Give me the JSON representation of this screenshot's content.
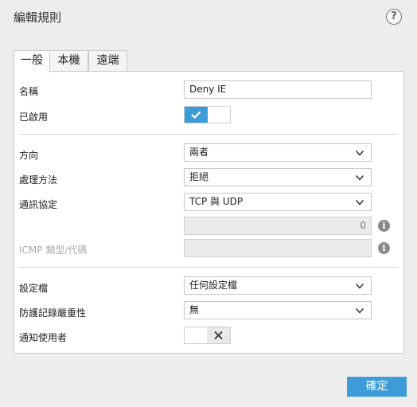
{
  "dialog": {
    "title": "編輯規則",
    "help_label": "?"
  },
  "tabs": [
    {
      "label": "一般"
    },
    {
      "label": "本機"
    },
    {
      "label": "遠端"
    }
  ],
  "fields": {
    "name": {
      "label": "名稱",
      "value": "Deny IE"
    },
    "enabled": {
      "label": "已啟用",
      "state": true
    },
    "direction": {
      "label": "方向",
      "value": "兩者"
    },
    "action": {
      "label": "處理方法",
      "value": "拒絕"
    },
    "protocol": {
      "label": "通訊協定",
      "value": "TCP 與 UDP"
    },
    "protocol_number": {
      "value": "0"
    },
    "icmp": {
      "label": "ICMP 類型/代碼",
      "value": ""
    },
    "profile": {
      "label": "設定檔",
      "value": "任何設定檔"
    },
    "log_severity": {
      "label": "防護記錄嚴重性",
      "value": "無"
    },
    "notify_user": {
      "label": "通知使用者",
      "state": false
    }
  },
  "footer": {
    "ok_label": "確定"
  },
  "colors": {
    "accent": "#3d9bd8",
    "background": "#ededed",
    "panel": "#ffffff"
  },
  "icons": {
    "help": "help-icon",
    "info": "info-icon",
    "check": "checkmark-icon",
    "cross": "close-icon",
    "chevron": "chevron-down-icon"
  }
}
